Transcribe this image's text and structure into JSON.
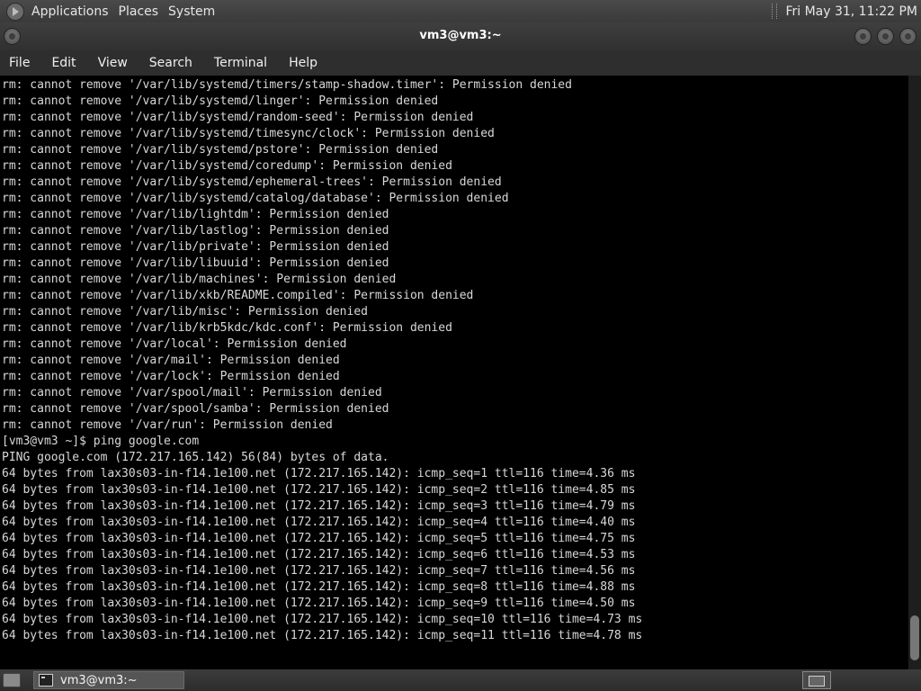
{
  "top_panel": {
    "menus": [
      "Applications",
      "Places",
      "System"
    ],
    "clock": "Fri May 31, 11:22 PM"
  },
  "window": {
    "title": "vm3@vm3:~"
  },
  "menubar": {
    "items": [
      "File",
      "Edit",
      "View",
      "Search",
      "Terminal",
      "Help"
    ]
  },
  "terminal": {
    "lines": [
      "rm: cannot remove '/var/lib/systemd/timers/stamp-shadow.timer': Permission denied",
      "rm: cannot remove '/var/lib/systemd/linger': Permission denied",
      "rm: cannot remove '/var/lib/systemd/random-seed': Permission denied",
      "rm: cannot remove '/var/lib/systemd/timesync/clock': Permission denied",
      "rm: cannot remove '/var/lib/systemd/pstore': Permission denied",
      "rm: cannot remove '/var/lib/systemd/coredump': Permission denied",
      "rm: cannot remove '/var/lib/systemd/ephemeral-trees': Permission denied",
      "rm: cannot remove '/var/lib/systemd/catalog/database': Permission denied",
      "rm: cannot remove '/var/lib/lightdm': Permission denied",
      "rm: cannot remove '/var/lib/lastlog': Permission denied",
      "rm: cannot remove '/var/lib/private': Permission denied",
      "rm: cannot remove '/var/lib/libuuid': Permission denied",
      "rm: cannot remove '/var/lib/machines': Permission denied",
      "rm: cannot remove '/var/lib/xkb/README.compiled': Permission denied",
      "rm: cannot remove '/var/lib/misc': Permission denied",
      "rm: cannot remove '/var/lib/krb5kdc/kdc.conf': Permission denied",
      "rm: cannot remove '/var/local': Permission denied",
      "rm: cannot remove '/var/mail': Permission denied",
      "rm: cannot remove '/var/lock': Permission denied",
      "rm: cannot remove '/var/spool/mail': Permission denied",
      "rm: cannot remove '/var/spool/samba': Permission denied",
      "rm: cannot remove '/var/run': Permission denied",
      "[vm3@vm3 ~]$ ping google.com",
      "PING google.com (172.217.165.142) 56(84) bytes of data.",
      "64 bytes from lax30s03-in-f14.1e100.net (172.217.165.142): icmp_seq=1 ttl=116 time=4.36 ms",
      "64 bytes from lax30s03-in-f14.1e100.net (172.217.165.142): icmp_seq=2 ttl=116 time=4.85 ms",
      "64 bytes from lax30s03-in-f14.1e100.net (172.217.165.142): icmp_seq=3 ttl=116 time=4.79 ms",
      "64 bytes from lax30s03-in-f14.1e100.net (172.217.165.142): icmp_seq=4 ttl=116 time=4.40 ms",
      "64 bytes from lax30s03-in-f14.1e100.net (172.217.165.142): icmp_seq=5 ttl=116 time=4.75 ms",
      "64 bytes from lax30s03-in-f14.1e100.net (172.217.165.142): icmp_seq=6 ttl=116 time=4.53 ms",
      "64 bytes from lax30s03-in-f14.1e100.net (172.217.165.142): icmp_seq=7 ttl=116 time=4.56 ms",
      "64 bytes from lax30s03-in-f14.1e100.net (172.217.165.142): icmp_seq=8 ttl=116 time=4.88 ms",
      "64 bytes from lax30s03-in-f14.1e100.net (172.217.165.142): icmp_seq=9 ttl=116 time=4.50 ms",
      "64 bytes from lax30s03-in-f14.1e100.net (172.217.165.142): icmp_seq=10 ttl=116 time=4.73 ms",
      "64 bytes from lax30s03-in-f14.1e100.net (172.217.165.142): icmp_seq=11 ttl=116 time=4.78 ms"
    ]
  },
  "taskbar": {
    "task_label": "vm3@vm3:~"
  }
}
